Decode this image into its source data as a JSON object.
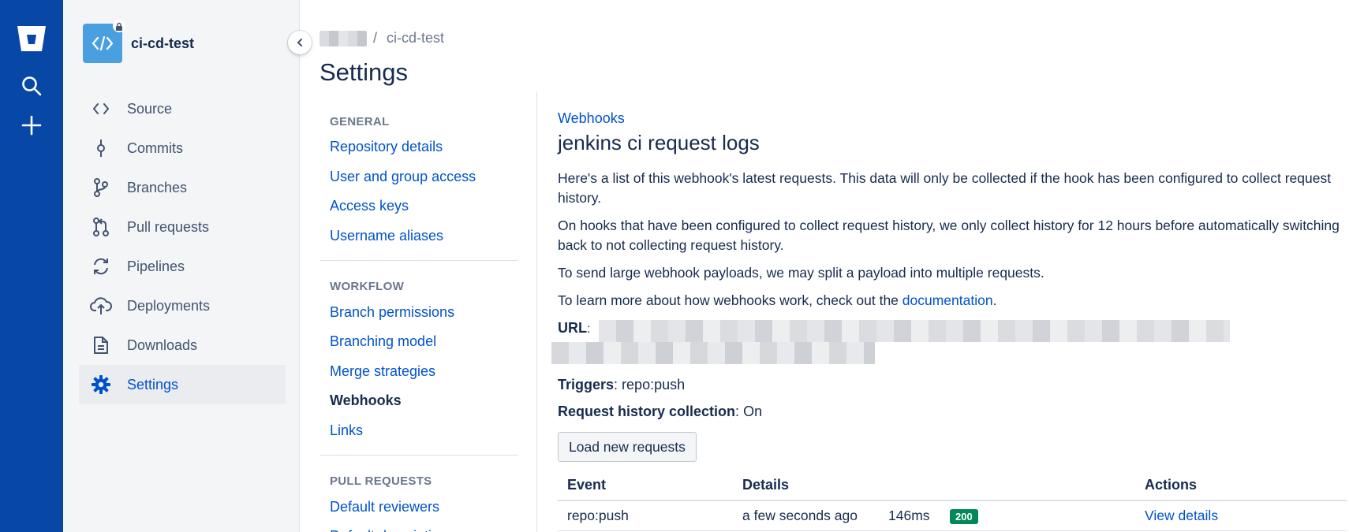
{
  "global_nav": {
    "items": [
      "bitbucket-logo",
      "search",
      "create"
    ]
  },
  "repo": {
    "name": "ci-cd-test"
  },
  "sidebar": {
    "items": [
      {
        "label": "Source",
        "icon": "code-icon"
      },
      {
        "label": "Commits",
        "icon": "commit-icon"
      },
      {
        "label": "Branches",
        "icon": "branch-icon"
      },
      {
        "label": "Pull requests",
        "icon": "pull-request-icon"
      },
      {
        "label": "Pipelines",
        "icon": "pipelines-icon"
      },
      {
        "label": "Deployments",
        "icon": "deployments-icon"
      },
      {
        "label": "Downloads",
        "icon": "downloads-icon"
      },
      {
        "label": "Settings",
        "icon": "settings-icon",
        "active": true
      }
    ]
  },
  "breadcrumbs": {
    "separator": "/",
    "repo": "ci-cd-test"
  },
  "page": {
    "title": "Settings"
  },
  "settings_nav": {
    "general": {
      "heading": "GENERAL",
      "links": [
        "Repository details",
        "User and group access",
        "Access keys",
        "Username aliases"
      ]
    },
    "workflow": {
      "heading": "WORKFLOW",
      "links": [
        "Branch permissions",
        "Branching model",
        "Merge strategies",
        "Webhooks",
        "Links"
      ]
    },
    "pull_requests": {
      "heading": "PULL REQUESTS",
      "links": [
        "Default reviewers",
        "Default description"
      ]
    }
  },
  "content": {
    "crumb": "Webhooks",
    "title": "jenkins ci request logs",
    "para1": "Here's a list of this webhook's latest requests. This data will only be collected if the hook has been configured to collect request history.",
    "para2": "On hooks that have been configured to collect request history, we only collect history for 12 hours before automatically switching back to not collecting request history.",
    "para3": "To send large webhook payloads, we may split a payload into multiple requests.",
    "para4_prefix": "To learn more about how webhooks work, check out the ",
    "para4_link": "documentation",
    "para4_suffix": ".",
    "url_label": "URL",
    "triggers_label": "Triggers",
    "triggers_value": "repo:push",
    "history_label": "Request history collection",
    "history_value": "On",
    "load_button": "Load new requests"
  },
  "table": {
    "headers": {
      "event": "Event",
      "details": "Details",
      "actions": "Actions"
    },
    "rows": [
      {
        "event": "repo:push",
        "time": "a few seconds ago",
        "duration": "146ms",
        "status": "200",
        "action": "View details"
      }
    ]
  },
  "colors": {
    "global_nav": "#0747a6",
    "link": "#0052cc",
    "success": "#00875a",
    "repo_avatar": "#4a9fe0"
  }
}
